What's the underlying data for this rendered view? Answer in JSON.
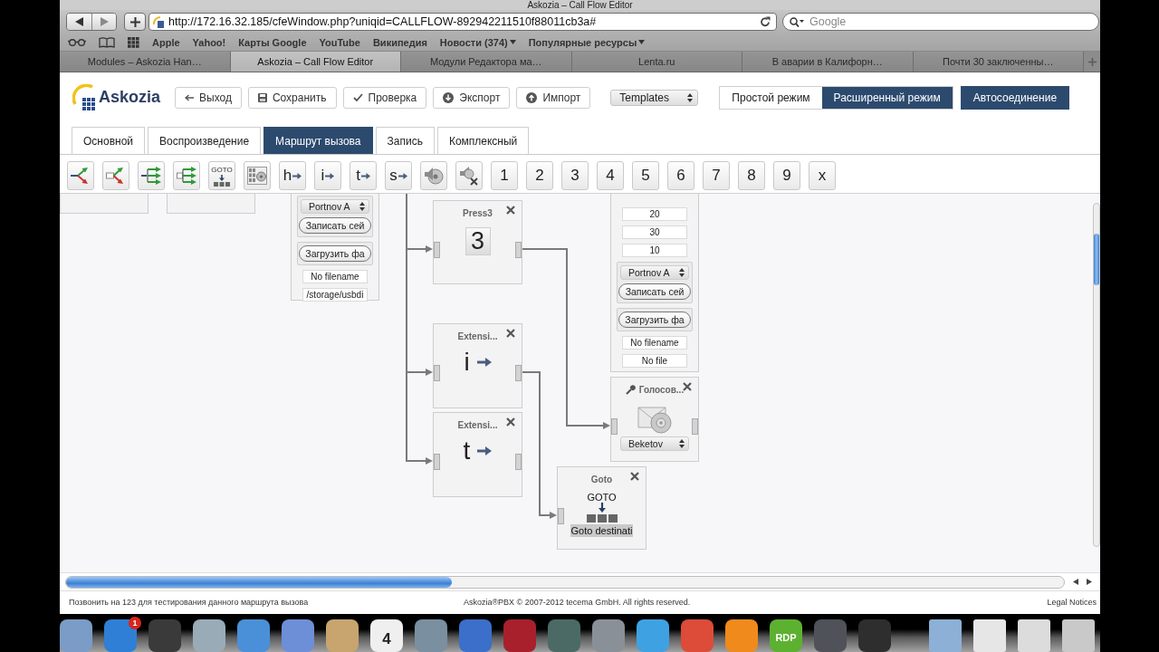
{
  "browser": {
    "title": "Askozia – Call Flow Editor",
    "url": "http://172.16.32.185/cfeWindow.php?uniqid=CALLFLOW-892942211510f88011cb3a#",
    "search_placeholder": "Google",
    "bookmarks": [
      {
        "label": "Apple",
        "menu": false
      },
      {
        "label": "Yahoo!",
        "menu": false
      },
      {
        "label": "Карты Google",
        "menu": false
      },
      {
        "label": "YouTube",
        "menu": false
      },
      {
        "label": "Википедия",
        "menu": false
      },
      {
        "label": "Новости (374)",
        "menu": true
      },
      {
        "label": "Популярные ресурсы",
        "menu": true
      }
    ],
    "tabs": [
      {
        "label": "Modules – Askozia Han…",
        "selected": false
      },
      {
        "label": "Askozia – Call Flow Editor",
        "selected": true
      },
      {
        "label": "Модули Редактора ма…",
        "selected": false
      },
      {
        "label": "Lenta.ru",
        "selected": false
      },
      {
        "label": "В аварии в Калифорн…",
        "selected": false
      },
      {
        "label": "Почти 30 заключенны…",
        "selected": false
      }
    ]
  },
  "app": {
    "logo": "Askozia",
    "actions": [
      {
        "kind": "back",
        "label": "Выход"
      },
      {
        "kind": "save",
        "label": "Сохранить"
      },
      {
        "kind": "check",
        "label": "Проверка"
      },
      {
        "kind": "export",
        "label": "Экспорт"
      },
      {
        "kind": "import",
        "label": "Импорт"
      }
    ],
    "templates": {
      "value": "Templates"
    },
    "modes": [
      {
        "label": "Простой режим",
        "selected": false
      },
      {
        "label": "Расширенный режим",
        "selected": true
      }
    ],
    "autoconnect": {
      "label": "Автосоединение",
      "on": true
    },
    "tabs": [
      {
        "label": "Основной",
        "selected": false
      },
      {
        "label": "Воспроизведение",
        "selected": false
      },
      {
        "label": "Маршрут вызова",
        "selected": true
      },
      {
        "label": "Запись",
        "selected": false
      },
      {
        "label": "Комплексный",
        "selected": false
      }
    ],
    "tools": [
      {
        "kind": "split"
      },
      {
        "kind": "split-box"
      },
      {
        "kind": "fan"
      },
      {
        "kind": "fan-box"
      },
      {
        "kind": "goto",
        "label": "GOTO"
      },
      {
        "kind": "keypad"
      },
      {
        "kind": "letter",
        "label": "h"
      },
      {
        "kind": "letter",
        "label": "i"
      },
      {
        "kind": "letter",
        "label": "t"
      },
      {
        "kind": "letter",
        "label": "s"
      },
      {
        "kind": "sound"
      },
      {
        "kind": "sound-off"
      },
      {
        "kind": "key",
        "label": "1"
      },
      {
        "kind": "key",
        "label": "2"
      },
      {
        "kind": "key",
        "label": "3"
      },
      {
        "kind": "key",
        "label": "4"
      },
      {
        "kind": "key",
        "label": "5"
      },
      {
        "kind": "key",
        "label": "6"
      },
      {
        "kind": "key",
        "label": "7"
      },
      {
        "kind": "key",
        "label": "8"
      },
      {
        "kind": "key",
        "label": "9"
      },
      {
        "kind": "key",
        "label": "x"
      }
    ],
    "nodes": [
      {
        "kind": "fragment"
      },
      {
        "kind": "fragment"
      },
      {
        "kind": "form",
        "controls": [
          {
            "kind": "group",
            "controls": [
              {
                "kind": "select",
                "value": "Portnov A"
              },
              {
                "kind": "button",
                "label": "Записать сей"
              }
            ]
          },
          {
            "kind": "group",
            "controls": [
              {
                "kind": "button",
                "label": "Загрузить фа"
              }
            ]
          },
          {
            "kind": "field",
            "value": "No filename"
          },
          {
            "kind": "field",
            "value": "/storage/usbdi"
          }
        ]
      },
      {
        "kind": "key",
        "title": "Press3",
        "key": "3",
        "closable": true
      },
      {
        "kind": "extension",
        "title": "Extensi...",
        "letter": "i",
        "closable": true
      },
      {
        "kind": "extension",
        "title": "Extensi...",
        "letter": "t",
        "closable": true
      },
      {
        "kind": "form",
        "controls": [
          {
            "kind": "field",
            "value": "20"
          },
          {
            "kind": "field",
            "value": "30"
          },
          {
            "kind": "field",
            "value": "10"
          },
          {
            "kind": "group",
            "controls": [
              {
                "kind": "select",
                "value": "Portnov A"
              },
              {
                "kind": "button",
                "label": "Записать сей"
              }
            ]
          },
          {
            "kind": "group",
            "controls": [
              {
                "kind": "button",
                "label": "Загрузить фа"
              }
            ]
          },
          {
            "kind": "field",
            "value": "No filename"
          },
          {
            "kind": "field",
            "value": "No file"
          }
        ]
      },
      {
        "kind": "voicemail",
        "title": "Голосов...",
        "select": "Beketov",
        "closable": true
      },
      {
        "kind": "goto",
        "title": "Goto",
        "label": "GOTO",
        "destination": "Goto destinati",
        "closable": true
      }
    ],
    "footer": {
      "hint": "Позвонить на 123 для тестирования данного маршрута вызова",
      "copyright": "Askozia®PBX © 2007-2012 tecema GmbH. All rights reserved.",
      "legal": "Legal Notices"
    }
  },
  "dock": [
    {
      "kind": "app",
      "color": "#7a9cc6"
    },
    {
      "kind": "app",
      "color": "#2f7fd6",
      "badge": "1"
    },
    {
      "kind": "app",
      "color": "#3a3a3a"
    },
    {
      "kind": "app",
      "color": "#9aabb8"
    },
    {
      "kind": "app",
      "color": "#4a90d9"
    },
    {
      "kind": "app",
      "color": "#6d8fd8"
    },
    {
      "kind": "app",
      "color": "#c8a46e"
    },
    {
      "kind": "app",
      "color": "#efefef",
      "label": "4"
    },
    {
      "kind": "app",
      "color": "#7a8fa0"
    },
    {
      "kind": "app",
      "color": "#3b6fc9"
    },
    {
      "kind": "app",
      "color": "#a8202c"
    },
    {
      "kind": "app",
      "color": "#4b6a66"
    },
    {
      "kind": "app",
      "color": "#8a9098"
    },
    {
      "kind": "app",
      "color": "#3ea2e2"
    },
    {
      "kind": "app",
      "color": "#dd4b39"
    },
    {
      "kind": "app",
      "color": "#f08a1c"
    },
    {
      "kind": "app",
      "color": "#5db131",
      "label": "RDP"
    },
    {
      "kind": "app",
      "color": "#50525a"
    },
    {
      "kind": "app",
      "color": "#2e2e2e"
    },
    {
      "kind": "folder",
      "color": "#8cb0d6"
    },
    {
      "kind": "folder",
      "color": "#e6e6e6"
    },
    {
      "kind": "folder",
      "color": "#dcdcdc"
    },
    {
      "kind": "folder",
      "color": "#c9c9c9"
    }
  ]
}
